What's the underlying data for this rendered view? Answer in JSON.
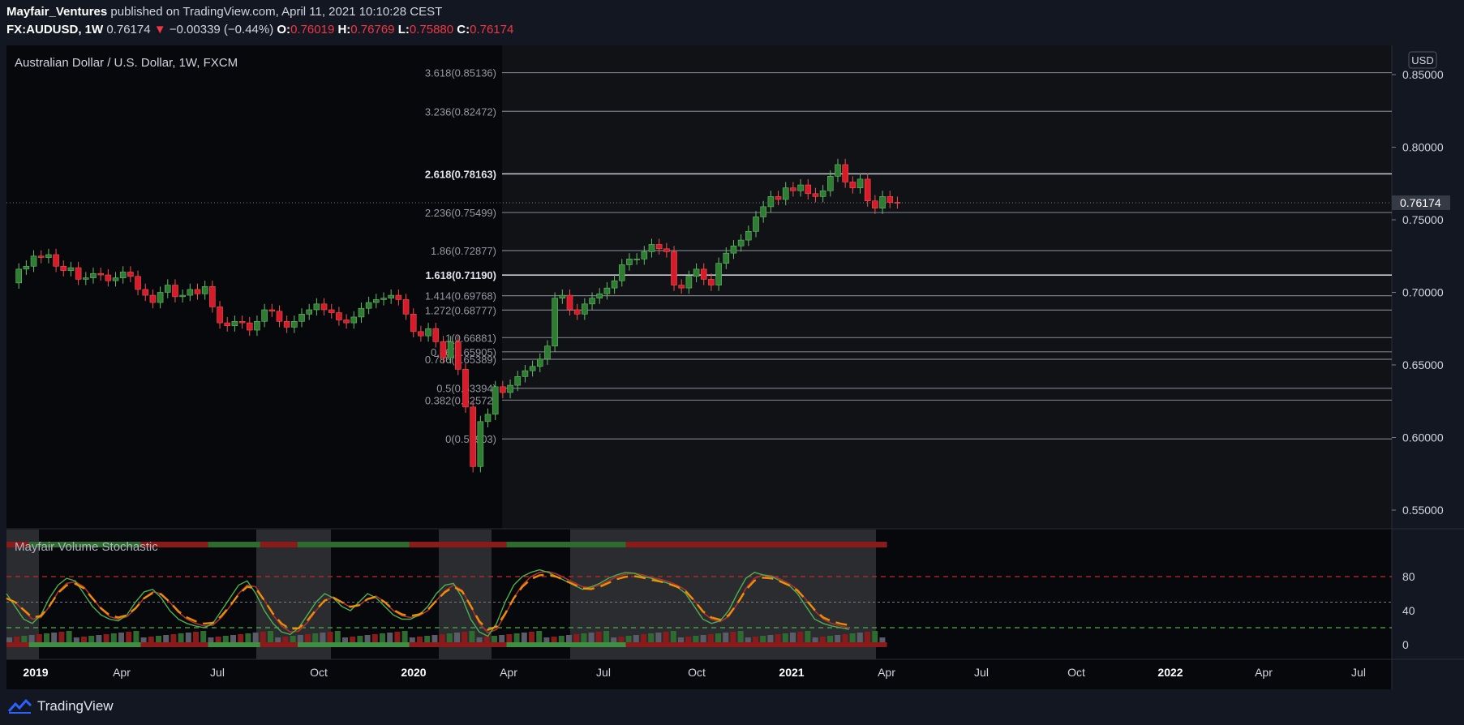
{
  "header": {
    "author": "Mayfair_Ventures",
    "published": " published on TradingView.com, April 11, 2021 10:10:28 CEST",
    "symbol": "FX:AUDUSD, 1W",
    "last": "0.76174",
    "arrow": "▼",
    "change": "−0.00339 (−0.44%)",
    "o_label": "O:",
    "o_value": "0.76019",
    "h_label": "H:",
    "h_value": "0.76769",
    "l_label": "L:",
    "l_value": "0.75880",
    "c_label": "C:",
    "c_value": "0.76174"
  },
  "footer": {
    "brand": "TradingView"
  },
  "colors": {
    "background": "#131722",
    "panel": "#06080c",
    "up": "#2e7d32",
    "down": "#d81b2a",
    "text": "#d1d4dc",
    "accent_orange": "#ff9800",
    "red_dash": "#c62828",
    "green_dash": "#4caf50"
  },
  "chart_data": {
    "type": "candlestick",
    "title": "Australian Dollar / U.S. Dollar, 1W, FXCM",
    "currency": "USD",
    "last_price": 0.76174,
    "last_price_label": "0.76174",
    "ylim": [
      0.535,
      0.865
    ],
    "y_ticks": [
      "0.85000",
      "0.80000",
      "0.75000",
      "0.70000",
      "0.65000",
      "0.60000",
      "0.55000"
    ],
    "x_ticks": [
      "2019",
      "Apr",
      "Jul",
      "Oct",
      "2020",
      "Apr",
      "Jul",
      "Oct",
      "2021",
      "Apr",
      "Jul",
      "Oct",
      "2022",
      "Apr",
      "Jul"
    ],
    "x_ticks_bold": [
      "2019",
      "2020",
      "2021",
      "2022"
    ],
    "fib_levels": [
      {
        "label": "3.618(0.85136)",
        "value": 0.85136
      },
      {
        "label": "3.236(0.82472)",
        "value": 0.82472
      },
      {
        "label": "2.618(0.78163)",
        "value": 0.78163
      },
      {
        "label": "2.236(0.75499)",
        "value": 0.75499
      },
      {
        "label": "1.86(0.72877)",
        "value": 0.72877
      },
      {
        "label": "1.618(0.71190)",
        "value": 0.7119
      },
      {
        "label": "1.414(0.69768)",
        "value": 0.69768
      },
      {
        "label": "1.272(0.68777)",
        "value": 0.68777
      },
      {
        "label": "1(0.66881)",
        "value": 0.66881
      },
      {
        "label": "0.86(0.65905)",
        "value": 0.65905
      },
      {
        "label": "0.786(0.65389)",
        "value": 0.65389
      },
      {
        "label": "0.5(0.63394)",
        "value": 0.63394
      },
      {
        "label": "0.382(0.62572)",
        "value": 0.62572
      },
      {
        "label": "0(0.59903)",
        "value": 0.59903
      }
    ],
    "closes": [
      0.7065,
      0.716,
      0.718,
      0.725,
      0.724,
      0.726,
      0.718,
      0.715,
      0.717,
      0.709,
      0.71,
      0.713,
      0.712,
      0.708,
      0.71,
      0.714,
      0.711,
      0.702,
      0.698,
      0.693,
      0.7,
      0.705,
      0.697,
      0.698,
      0.702,
      0.699,
      0.704,
      0.69,
      0.679,
      0.677,
      0.68,
      0.679,
      0.674,
      0.68,
      0.688,
      0.687,
      0.68,
      0.676,
      0.68,
      0.685,
      0.688,
      0.692,
      0.688,
      0.686,
      0.681,
      0.679,
      0.683,
      0.689,
      0.693,
      0.695,
      0.696,
      0.698,
      0.695,
      0.685,
      0.673,
      0.67,
      0.675,
      0.666,
      0.655,
      0.666,
      0.647,
      0.621,
      0.58,
      0.611,
      0.616,
      0.635,
      0.631,
      0.636,
      0.642,
      0.646,
      0.649,
      0.654,
      0.663,
      0.696,
      0.698,
      0.688,
      0.685,
      0.692,
      0.696,
      0.699,
      0.703,
      0.708,
      0.719,
      0.723,
      0.723,
      0.728,
      0.733,
      0.73,
      0.728,
      0.705,
      0.703,
      0.711,
      0.716,
      0.709,
      0.705,
      0.72,
      0.727,
      0.732,
      0.736,
      0.742,
      0.752,
      0.759,
      0.766,
      0.764,
      0.772,
      0.77,
      0.774,
      0.768,
      0.766,
      0.77,
      0.78,
      0.788,
      0.776,
      0.772,
      0.778,
      0.763,
      0.758,
      0.766,
      0.762,
      0.7617
    ],
    "oscillator": {
      "title": "Mayfair Volume Stochastic",
      "levels": [
        "80",
        "40",
        "0"
      ],
      "upper_band": 80,
      "mid_band": 50,
      "lower_band": 20,
      "k": [
        60,
        45,
        30,
        25,
        35,
        55,
        70,
        78,
        75,
        60,
        45,
        35,
        30,
        28,
        35,
        50,
        62,
        65,
        55,
        40,
        30,
        25,
        22,
        20,
        25,
        40,
        55,
        70,
        75,
        60,
        40,
        25,
        15,
        12,
        20,
        35,
        50,
        60,
        55,
        45,
        40,
        50,
        60,
        55,
        45,
        35,
        30,
        30,
        35,
        45,
        60,
        70,
        72,
        55,
        30,
        15,
        10,
        25,
        50,
        70,
        80,
        85,
        88,
        85,
        80,
        75,
        70,
        65,
        68,
        72,
        78,
        82,
        85,
        84,
        80,
        78,
        75,
        72,
        68,
        60,
        45,
        30,
        25,
        28,
        40,
        60,
        78,
        85,
        82,
        80,
        75,
        70,
        60,
        45,
        30,
        25,
        22,
        20,
        18
      ],
      "d": [
        55,
        50,
        40,
        30,
        32,
        45,
        62,
        72,
        74,
        68,
        55,
        42,
        33,
        30,
        33,
        42,
        55,
        62,
        60,
        50,
        38,
        30,
        25,
        22,
        23,
        32,
        45,
        60,
        70,
        68,
        52,
        35,
        22,
        15,
        16,
        26,
        40,
        52,
        56,
        50,
        44,
        46,
        54,
        57,
        50,
        40,
        34,
        32,
        34,
        40,
        52,
        63,
        70,
        64,
        45,
        25,
        14,
        18,
        35,
        55,
        70,
        80,
        85,
        86,
        83,
        78,
        73,
        68,
        67,
        70,
        75,
        80,
        83,
        84,
        82,
        79,
        77,
        74,
        70,
        64,
        52,
        38,
        30,
        27,
        33,
        48,
        66,
        78,
        82,
        81,
        77,
        72,
        65,
        53,
        40,
        30,
        25,
        22,
        20
      ],
      "red_segments": [
        [
          0,
          3
        ],
        [
          18,
          27
        ],
        [
          34,
          39
        ],
        [
          54,
          67
        ],
        [
          83,
          118
        ]
      ],
      "green_segments": [
        [
          3,
          18
        ],
        [
          27,
          34
        ],
        [
          39,
          54
        ],
        [
          67,
          83
        ]
      ]
    }
  }
}
